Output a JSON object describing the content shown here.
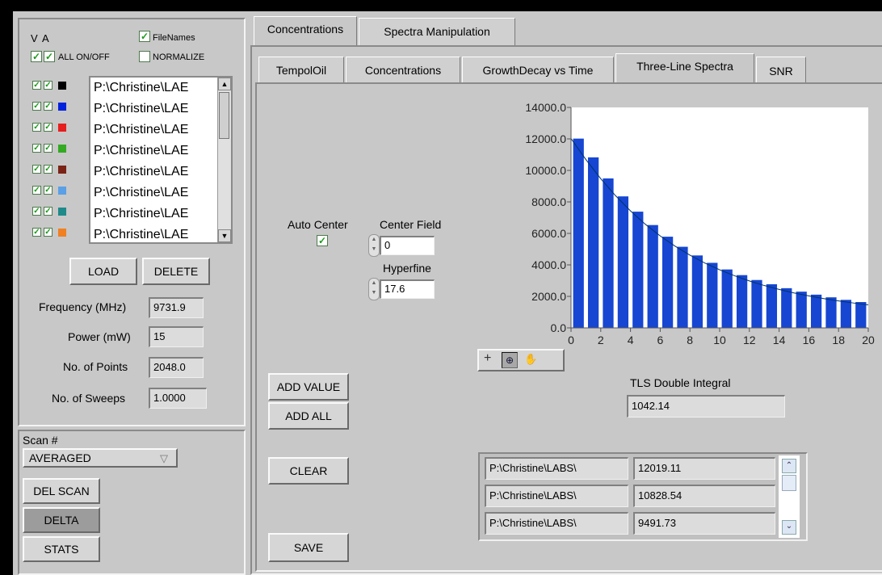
{
  "left": {
    "header_v": "V",
    "header_a": "A",
    "filenames_label": "FileNames",
    "all_on_off_label": "ALL ON/OFF",
    "normalize_label": "NORMALIZE",
    "files": [
      {
        "name": "P:\\Christine\\LAE",
        "color": "#000000"
      },
      {
        "name": "P:\\Christine\\LAE",
        "color": "#0022dd"
      },
      {
        "name": "P:\\Christine\\LAE",
        "color": "#e61e1e"
      },
      {
        "name": "P:\\Christine\\LAE",
        "color": "#33aa22"
      },
      {
        "name": "P:\\Christine\\LAE",
        "color": "#7a2416"
      },
      {
        "name": "P:\\Christine\\LAE",
        "color": "#5aa0e6"
      },
      {
        "name": "P:\\Christine\\LAE",
        "color": "#1f8a8a"
      },
      {
        "name": "P:\\Christine\\LAE",
        "color": "#f08020"
      }
    ],
    "load_label": "LOAD",
    "delete_label": "DELETE",
    "frequency_label": "Frequency (MHz)",
    "frequency_value": "9731.9",
    "power_label": "Power (mW)",
    "power_value": "15",
    "points_label": "No. of Points",
    "points_value": "2048.0",
    "sweeps_label": "No. of Sweeps",
    "sweeps_value": "1.0000",
    "scan_label": "Scan #",
    "scan_value": "AVERAGED",
    "del_scan_label": "DEL SCAN",
    "delta_label": "DELTA",
    "stats_label": "STATS"
  },
  "tabs_top": [
    "Concentrations",
    "Spectra Manipulation"
  ],
  "tabs_sub": [
    "TempolOil",
    "Concentrations",
    "GrowthDecay vs Time",
    "Three-Line Spectra",
    "SNR"
  ],
  "main": {
    "auto_center_label": "Auto Center",
    "center_field_label": "Center Field",
    "center_field_value": "0",
    "hyperfine_label": "Hyperfine",
    "hyperfine_value": "17.6",
    "add_value_label": "ADD VALUE",
    "add_all_label": "ADD ALL",
    "clear_label": "CLEAR",
    "save_label": "SAVE",
    "tls_label": "TLS Double Integral",
    "tls_value": "1042.14",
    "results": [
      {
        "file": "P:\\Christine\\LABS\\",
        "value": "12019.11"
      },
      {
        "file": "P:\\Christine\\LABS\\",
        "value": "10828.54"
      },
      {
        "file": "P:\\Christine\\LABS\\",
        "value": "9491.73"
      }
    ]
  },
  "chart_data": {
    "type": "bar",
    "x": [
      0,
      1,
      2,
      3,
      4,
      5,
      6,
      7,
      8,
      9,
      10,
      11,
      12,
      13,
      14,
      15,
      16,
      17,
      18,
      19
    ],
    "values": [
      12019,
      10829,
      9492,
      8350,
      7380,
      6530,
      5790,
      5150,
      4600,
      4130,
      3710,
      3350,
      3040,
      2770,
      2520,
      2300,
      2110,
      1940,
      1780,
      1640
    ],
    "curve": [
      12019,
      10690,
      9470,
      8390,
      7430,
      6580,
      5840,
      5190,
      4620,
      4120,
      3690,
      3310,
      2980,
      2690,
      2440,
      2220,
      2030,
      1860,
      1710,
      1580,
      1460
    ],
    "xlim": [
      0,
      20
    ],
    "ylim": [
      0,
      14000
    ],
    "xticks": [
      "0",
      "2",
      "4",
      "6",
      "8",
      "10",
      "12",
      "14",
      "16",
      "18",
      "20"
    ],
    "yticks": [
      "0.0",
      "2000.0",
      "4000.0",
      "6000.0",
      "8000.0",
      "10000.0",
      "12000.0",
      "14000.0"
    ],
    "bar_color": "#1646d2",
    "curve_color": "#003366"
  }
}
